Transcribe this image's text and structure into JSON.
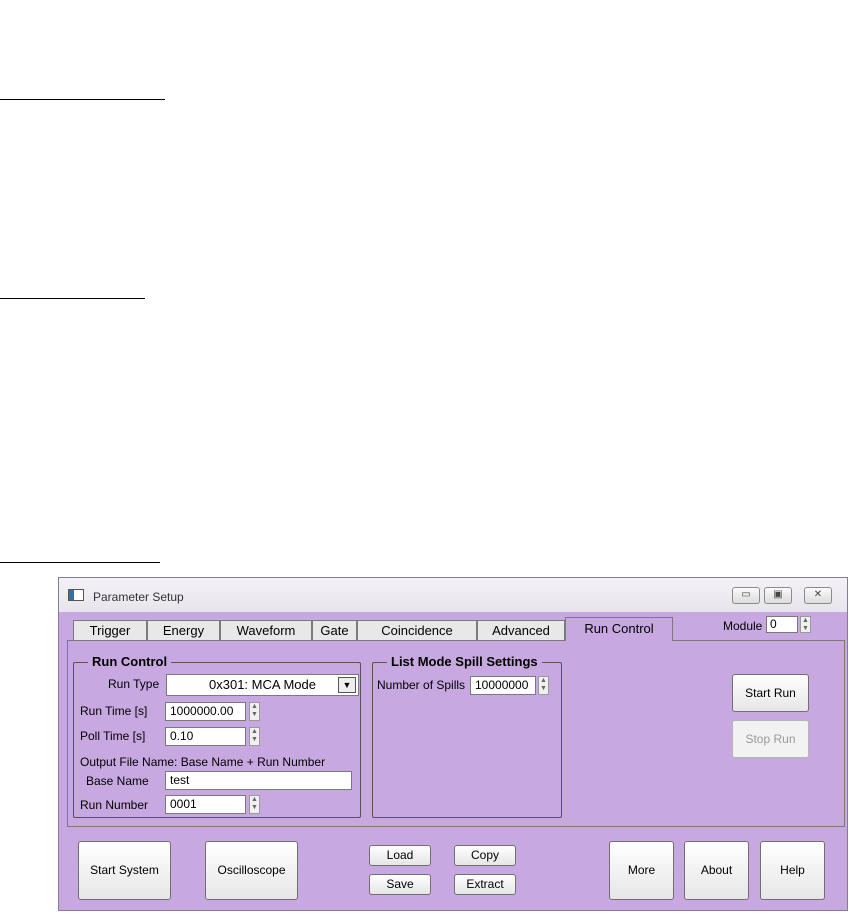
{
  "window": {
    "title": "Parameter Setup",
    "buttons": {
      "minimize": "▭",
      "maximize": "▣",
      "close": "✕"
    }
  },
  "tabs": [
    "Trigger",
    "Energy",
    "Waveform",
    "Gate",
    "Coincidence",
    "Advanced",
    "Run Control"
  ],
  "active_tab": "Run Control",
  "module": {
    "label": "Module",
    "value": "0"
  },
  "run_control": {
    "title": "Run Control",
    "run_type_label": "Run Type",
    "run_type_value": "0x301: MCA Mode",
    "run_time_label": "Run Time [s]",
    "run_time_value": "1000000.00",
    "poll_time_label": "Poll Time [s]",
    "poll_time_value": "0.10",
    "output_file_note": "Output File Name: Base Name + Run Number",
    "base_name_label": "Base Name",
    "base_name_value": "test",
    "run_number_label": "Run Number",
    "run_number_value": "0001"
  },
  "list_mode": {
    "title": "List Mode Spill Settings",
    "spills_label": "Number of Spills",
    "spills_value": "10000000"
  },
  "run_buttons": {
    "start": "Start Run",
    "stop": "Stop Run"
  },
  "bottom_buttons": {
    "start_system": "Start System",
    "oscilloscope": "Oscilloscope",
    "load": "Load",
    "save": "Save",
    "copy": "Copy",
    "extract": "Extract",
    "more": "More",
    "about": "About",
    "help": "Help"
  },
  "colors": {
    "window_bg": "#c8a8e0",
    "titlebar": "#eeeaf2"
  }
}
